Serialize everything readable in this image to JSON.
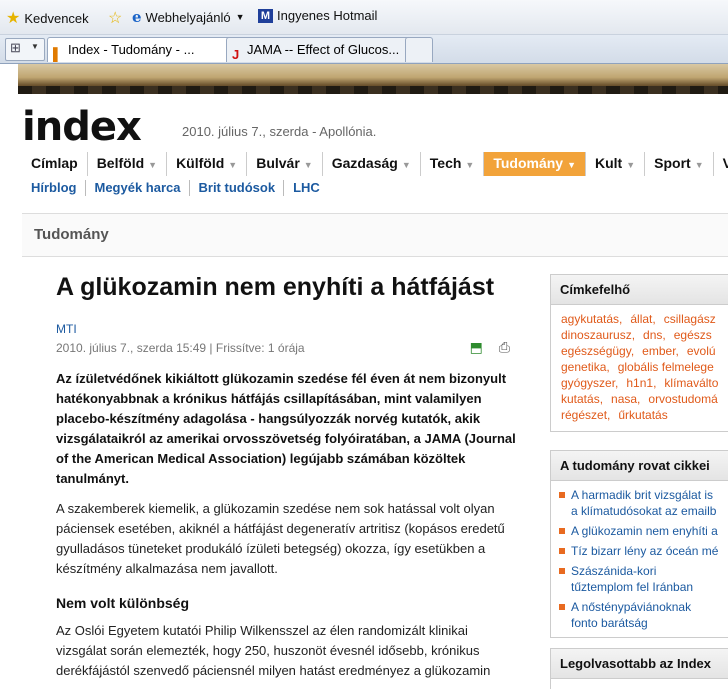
{
  "browser": {
    "favorites_label": "Kedvencek",
    "fav_links": [
      "Webhelyajánló",
      "Ingyenes Hotmail"
    ],
    "tabs": [
      {
        "label": "Index - Tudomány - ...",
        "icon": "I"
      },
      {
        "label": "JAMA -- Effect of Glucos...",
        "icon": "J"
      }
    ]
  },
  "site": {
    "logo": "index",
    "date": "2010. július  7., szerda - Apollónia.",
    "nav": [
      "Címlap",
      "Belföld",
      "Külföld",
      "Bulvár",
      "Gazdaság",
      "Tech",
      "Tudomány",
      "Kult",
      "Sport",
      "Ve"
    ],
    "active_nav": "Tudomány",
    "subnav": [
      "Hírblog",
      "Megyék harca",
      "Brit tudósok",
      "LHC"
    ],
    "section": "Tudomány"
  },
  "article": {
    "title": "A glükozamin nem enyhíti a hátfájást",
    "author": "MTI",
    "meta": "2010. július 7., szerda 15:49 | Frissítve: 1 órája",
    "lead": "Az ízületvédőnek kikiáltott glükozamin szedése fél éven át nem bizonyult hatékonyabbnak a krónikus hátfájás csillapításában, mint valamilyen placebo-készítmény adagolása - hangsúlyozzák norvég kutatók, akik vizsgálataikról az amerikai orvosszövetség folyóiratában, a JAMA (Journal of the American Medical Association) legújabb számában közöltek tanulmányt.",
    "p1": "A szakemberek kiemelik, a glükozamin szedése nem sok hatással volt olyan páciensek esetében, akiknél a hátfájást degeneratív artritisz (kopásos eredetű gyulladásos tüneteket produkáló ízületi betegség) okozza, így esetükben a készítmény alkalmazása nem javallott.",
    "subheading": "Nem volt különbség",
    "p2": "Az Oslói Egyetem kutatói Philip Wilkensszel az élen randomizált klinikai vizsgálat során elemezték, hogy 250, huszonöt évesnél idősebb, krónikus derékfájástól szenvedő páciensnél milyen hatást eredményez a glükozamin"
  },
  "sidebar": {
    "tagcloud_title": "Címkefelhő",
    "tags": [
      "agykutatás,",
      "állat,",
      "csillagász",
      "dinoszaurusz,",
      "dns,",
      "egészs",
      "egészségügy,",
      "ember,",
      "evolú",
      "genetika,",
      "globális felmelege",
      "gyógyszer,",
      "h1n1,",
      "klímaválto",
      "kutatás,",
      "nasa,",
      "orvostudomá",
      "régészet,",
      "űrkutatás"
    ],
    "articles_title": "A tudomány rovat cikkei",
    "articles": [
      "A harmadik brit vizsgálat is a klímatudósokat az emailb",
      "A glükozamin nem enyhíti a",
      "Tíz bizarr lény az óceán mé",
      "Szászánida-kori tűztemplom fel Iránban",
      "A nősténypáviánoknak fonto barátság"
    ],
    "popular_title": "Legolvasottabb az Index"
  }
}
